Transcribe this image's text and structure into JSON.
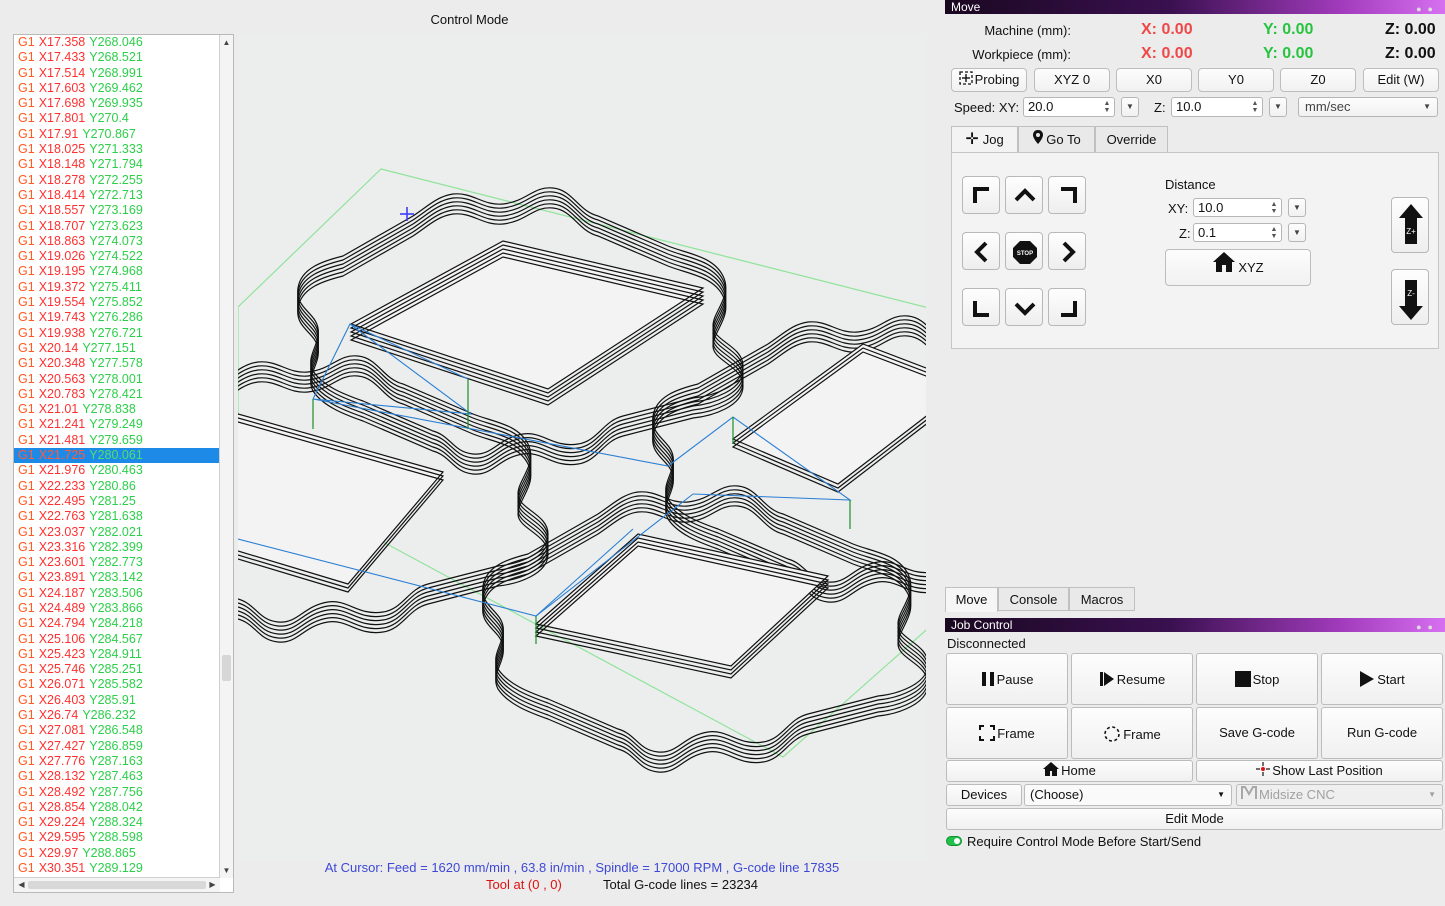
{
  "gcode": {
    "selected_index": 27,
    "lines": [
      {
        "g": "G1",
        "x": "X17.358",
        "y": "Y268.046"
      },
      {
        "g": "G1",
        "x": "X17.433",
        "y": "Y268.521"
      },
      {
        "g": "G1",
        "x": "X17.514",
        "y": "Y268.991"
      },
      {
        "g": "G1",
        "x": "X17.603",
        "y": "Y269.462"
      },
      {
        "g": "G1",
        "x": "X17.698",
        "y": "Y269.935"
      },
      {
        "g": "G1",
        "x": "X17.801",
        "y": "Y270.4"
      },
      {
        "g": "G1",
        "x": "X17.91",
        "y": "Y270.867"
      },
      {
        "g": "G1",
        "x": "X18.025",
        "y": "Y271.333"
      },
      {
        "g": "G1",
        "x": "X18.148",
        "y": "Y271.794"
      },
      {
        "g": "G1",
        "x": "X18.278",
        "y": "Y272.255"
      },
      {
        "g": "G1",
        "x": "X18.414",
        "y": "Y272.713"
      },
      {
        "g": "G1",
        "x": "X18.557",
        "y": "Y273.169"
      },
      {
        "g": "G1",
        "x": "X18.707",
        "y": "Y273.623"
      },
      {
        "g": "G1",
        "x": "X18.863",
        "y": "Y274.073"
      },
      {
        "g": "G1",
        "x": "X19.026",
        "y": "Y274.522"
      },
      {
        "g": "G1",
        "x": "X19.195",
        "y": "Y274.968"
      },
      {
        "g": "G1",
        "x": "X19.372",
        "y": "Y275.411"
      },
      {
        "g": "G1",
        "x": "X19.554",
        "y": "Y275.852"
      },
      {
        "g": "G1",
        "x": "X19.743",
        "y": "Y276.286"
      },
      {
        "g": "G1",
        "x": "X19.938",
        "y": "Y276.721"
      },
      {
        "g": "G1",
        "x": "X20.14",
        "y": "Y277.151"
      },
      {
        "g": "G1",
        "x": "X20.348",
        "y": "Y277.578"
      },
      {
        "g": "G1",
        "x": "X20.563",
        "y": "Y278.001"
      },
      {
        "g": "G1",
        "x": "X20.783",
        "y": "Y278.421"
      },
      {
        "g": "G1",
        "x": "X21.01",
        "y": "Y278.838"
      },
      {
        "g": "G1",
        "x": "X21.241",
        "y": "Y279.249"
      },
      {
        "g": "G1",
        "x": "X21.481",
        "y": "Y279.659"
      },
      {
        "g": "G1",
        "x": "X21.725",
        "y": "Y280.061"
      },
      {
        "g": "G1",
        "x": "X21.976",
        "y": "Y280.463"
      },
      {
        "g": "G1",
        "x": "X22.233",
        "y": "Y280.86"
      },
      {
        "g": "G1",
        "x": "X22.495",
        "y": "Y281.25"
      },
      {
        "g": "G1",
        "x": "X22.763",
        "y": "Y281.638"
      },
      {
        "g": "G1",
        "x": "X23.037",
        "y": "Y282.021"
      },
      {
        "g": "G1",
        "x": "X23.316",
        "y": "Y282.399"
      },
      {
        "g": "G1",
        "x": "X23.601",
        "y": "Y282.773"
      },
      {
        "g": "G1",
        "x": "X23.891",
        "y": "Y283.142"
      },
      {
        "g": "G1",
        "x": "X24.187",
        "y": "Y283.506"
      },
      {
        "g": "G1",
        "x": "X24.489",
        "y": "Y283.866"
      },
      {
        "g": "G1",
        "x": "X24.794",
        "y": "Y284.218"
      },
      {
        "g": "G1",
        "x": "X25.106",
        "y": "Y284.567"
      },
      {
        "g": "G1",
        "x": "X25.423",
        "y": "Y284.911"
      },
      {
        "g": "G1",
        "x": "X25.746",
        "y": "Y285.251"
      },
      {
        "g": "G1",
        "x": "X26.071",
        "y": "Y285.582"
      },
      {
        "g": "G1",
        "x": "X26.403",
        "y": "Y285.91"
      },
      {
        "g": "G1",
        "x": "X26.74",
        "y": "Y286.232"
      },
      {
        "g": "G1",
        "x": "X27.081",
        "y": "Y286.548"
      },
      {
        "g": "G1",
        "x": "X27.427",
        "y": "Y286.859"
      },
      {
        "g": "G1",
        "x": "X27.776",
        "y": "Y287.163"
      },
      {
        "g": "G1",
        "x": "X28.132",
        "y": "Y287.463"
      },
      {
        "g": "G1",
        "x": "X28.492",
        "y": "Y287.756"
      },
      {
        "g": "G1",
        "x": "X28.854",
        "y": "Y288.042"
      },
      {
        "g": "G1",
        "x": "X29.224",
        "y": "Y288.324"
      },
      {
        "g": "G1",
        "x": "X29.595",
        "y": "Y288.598"
      },
      {
        "g": "G1",
        "x": "X29.97",
        "y": "Y288.865"
      },
      {
        "g": "G1",
        "x": "X30.351",
        "y": "Y289.129"
      }
    ]
  },
  "viewer": {
    "title": "Control Mode",
    "status_line": "At Cursor: Feed = 1620 mm/min , 63.8 in/min ,  Spindle = 17000 RPM , G-code line 17835",
    "tool_position": "Tool at (0 , 0)",
    "total_lines": "Total G-code lines = 23234"
  },
  "move": {
    "title": "Move",
    "machine_label": "Machine (mm):",
    "workpiece_label": "Workpiece (mm):",
    "machine": {
      "x": "X: 0.00",
      "y": "Y: 0.00",
      "z": "Z: 0.00"
    },
    "workpiece": {
      "x": "X: 0.00",
      "y": "Y: 0.00",
      "z": "Z: 0.00"
    },
    "buttons": {
      "probing": "Probing",
      "xyz0": "XYZ 0",
      "x0": "X0",
      "y0": "Y0",
      "z0": "Z0",
      "edit": "Edit (W)"
    },
    "speed_label": "Speed: XY:",
    "speed_xy": "20.0",
    "z_label": "Z:",
    "speed_z": "10.0",
    "unit": "mm/sec",
    "tabs": {
      "jog": "Jog",
      "goto": "Go To",
      "override": "Override"
    },
    "distance_label": "Distance",
    "dist_xy_label": "XY:",
    "dist_xy": "10.0",
    "dist_z_label": "Z:",
    "dist_z": "0.1",
    "home_xyz": "XYZ",
    "stop_text": "STOP"
  },
  "panel_tabs": {
    "move": "Move",
    "console": "Console",
    "macros": "Macros"
  },
  "job": {
    "title": "Job Control",
    "status": "Disconnected",
    "pause": "Pause",
    "resume": "Resume",
    "stop": "Stop",
    "start": "Start",
    "frame1": "Frame",
    "frame2": "Frame",
    "save": "Save G-code",
    "run": "Run G-code",
    "home": "Home",
    "show_last": "Show Last Position",
    "devices": "Devices",
    "choose": "(Choose)",
    "machine": "Midsize CNC",
    "edit_mode": "Edit Mode",
    "require": "Require Control Mode Before Start/Send"
  },
  "colors": {
    "x_value": "#f04848",
    "y_value": "#27c43f",
    "selection": "#1d8ae8",
    "status_blue": "#3d48d6",
    "tool_red": "#e01010"
  }
}
